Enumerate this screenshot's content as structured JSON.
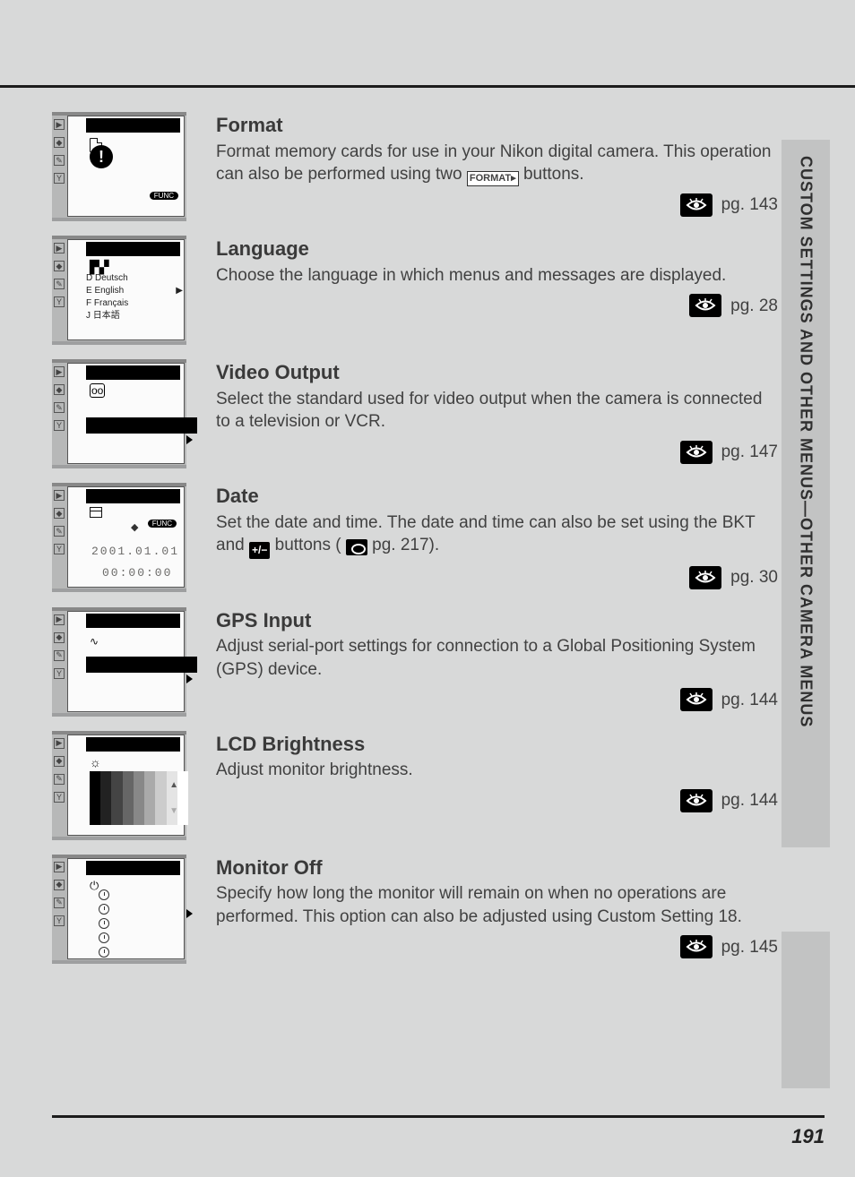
{
  "sidebar_label": "CUSTOM SETTINGS AND OTHER MENUS—OTHER CAMERA MENUS",
  "page_number": "191",
  "items": [
    {
      "title": "Format",
      "body_pre": "Format memory cards for use in your Nikon digital camera.  This operation can also be performed using two ",
      "body_post": " buttons.",
      "inline_label": "FORMAT▸",
      "page_ref": "pg. 143"
    },
    {
      "title": "Language",
      "body": "Choose the language in which menus and messages are displayed.",
      "page_ref": "pg. 28",
      "lang_options": [
        "D Deutsch",
        "E English",
        "F Français",
        "J 日本語"
      ]
    },
    {
      "title": "Video Output",
      "body": "Select the standard used for video output when the camera is connected to a television or VCR.",
      "page_ref": "pg. 147"
    },
    {
      "title": "Date",
      "body_pre": "Set the date and time.  The date and time can also be set using the BKT and ",
      "body_mid": " buttons (",
      "body_post": " pg. 217).",
      "page_ref": "pg. 30",
      "date_value": "2001.01.01",
      "time_value": "00:00:00"
    },
    {
      "title": "GPS Input",
      "body": "Adjust serial-port settings for connection to a Global Positioning System (GPS) device.",
      "page_ref": "pg. 144"
    },
    {
      "title": "LCD Brightness",
      "body": "Adjust monitor brightness.",
      "page_ref": "pg. 144"
    },
    {
      "title": "Monitor Off",
      "body": "Specify how long the monitor will remain on when no operations are performed. This option can also be adjusted using Custom Setting 18.",
      "page_ref": "pg. 145"
    }
  ]
}
